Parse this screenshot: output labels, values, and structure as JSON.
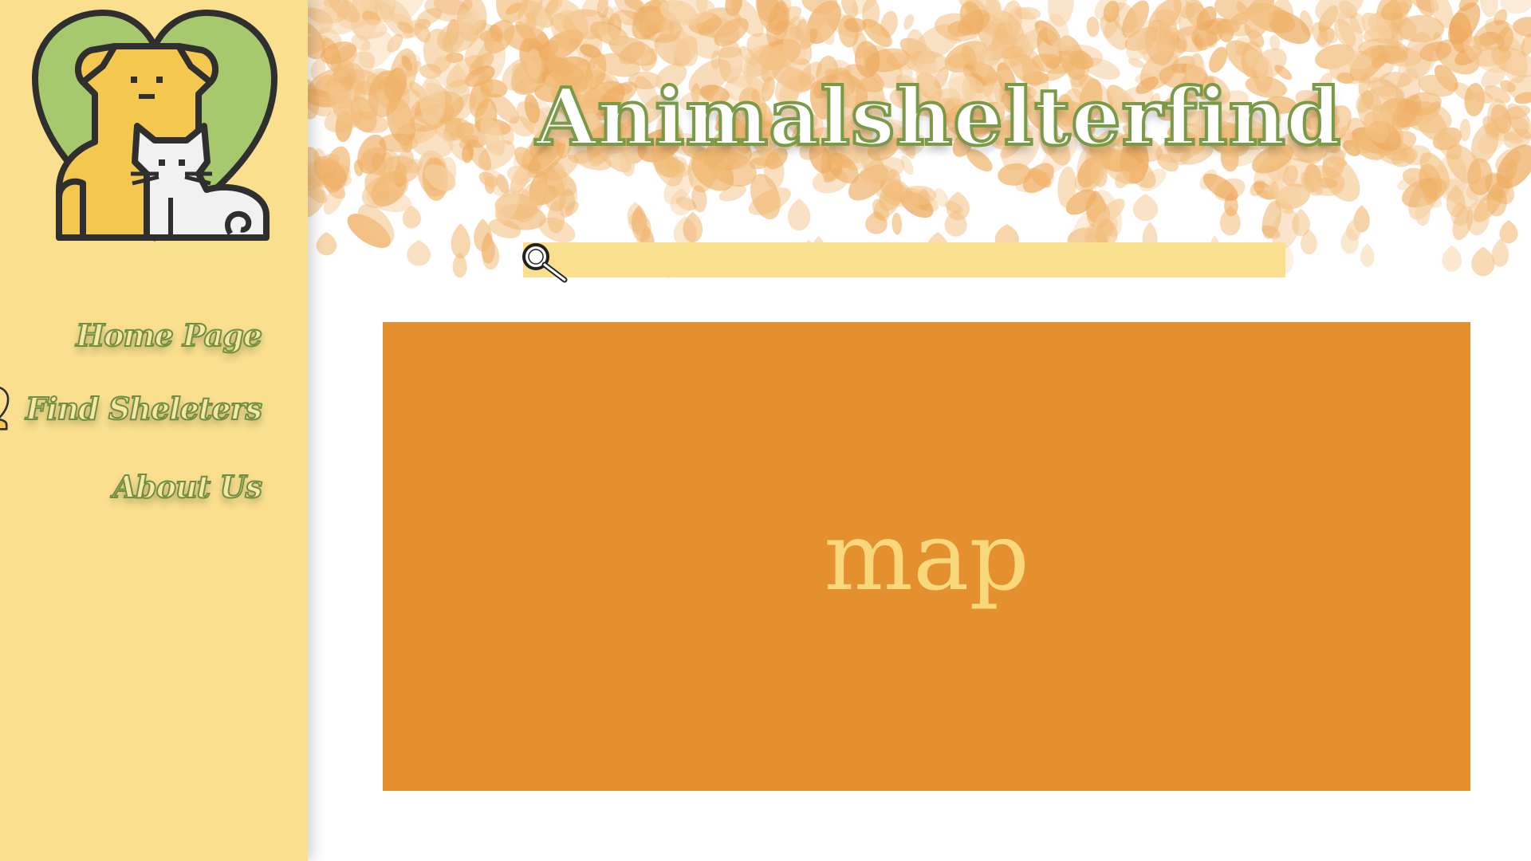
{
  "header": {
    "title": "Animalshelterfind"
  },
  "search": {
    "value": "",
    "placeholder": "",
    "icon": "magnifier-icon"
  },
  "sidebar": {
    "logo_icon": "dog-cat-heart-logo",
    "items": [
      {
        "label": "Home Page",
        "icon": null
      },
      {
        "label": "Find Sheleters",
        "icon": "dog-cat-heart-icon",
        "active": true
      },
      {
        "label": "About Us",
        "icon": null
      }
    ]
  },
  "map": {
    "label": "map"
  },
  "colors": {
    "sidebar_bg": "#f9df8e",
    "accent_green": "#7a9a48",
    "map_orange": "#e4902f",
    "map_text": "#f8d87a",
    "leaf_orange": "#f0b46a"
  }
}
